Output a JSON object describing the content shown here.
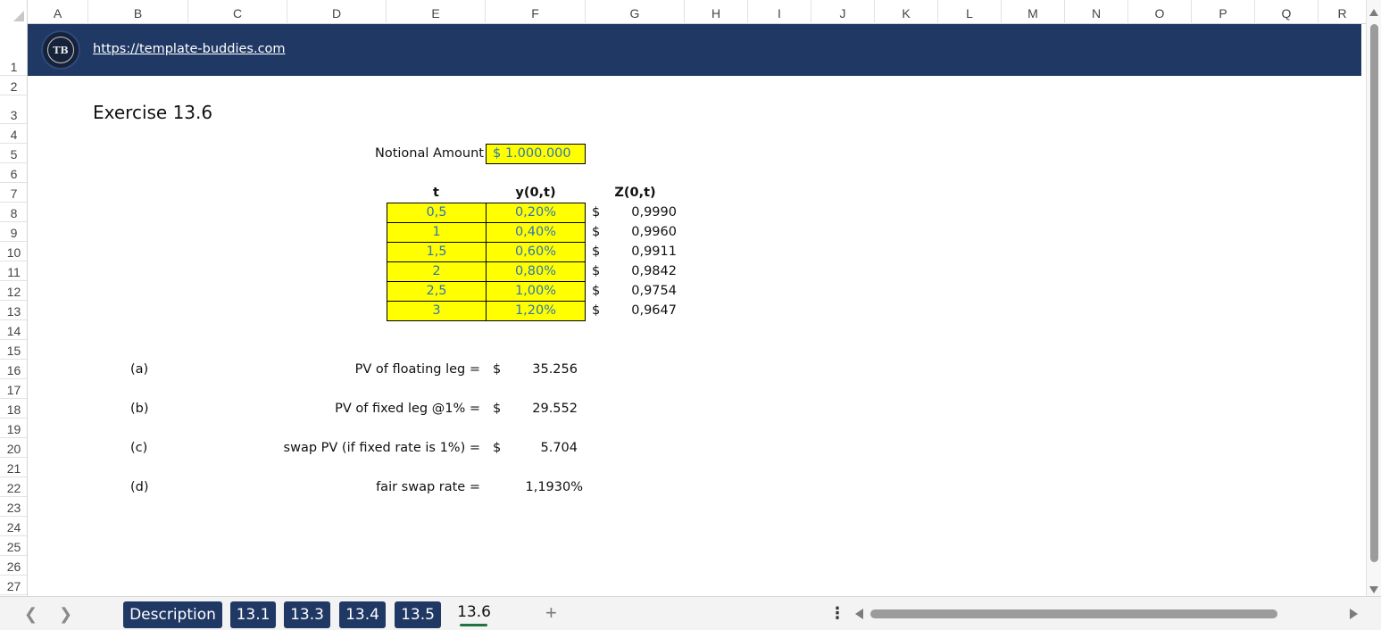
{
  "columns": [
    "A",
    "B",
    "C",
    "D",
    "E",
    "F",
    "G",
    "H",
    "I",
    "J",
    "K",
    "L",
    "M",
    "N",
    "O",
    "P",
    "Q",
    "R"
  ],
  "rows": [
    "1",
    "2",
    "3",
    "4",
    "5",
    "6",
    "7",
    "8",
    "9",
    "10",
    "11",
    "12",
    "13",
    "14",
    "15",
    "16",
    "17",
    "18",
    "19",
    "20",
    "21",
    "22",
    "23",
    "24",
    "25",
    "26",
    "27"
  ],
  "banner": {
    "logo_text": "TB",
    "link": "https://template-buddies.com"
  },
  "sheet": {
    "title": "Exercise 13.6",
    "notional_label": "Notional Amount",
    "notional_value": "$   1.000.000",
    "table": {
      "headers": [
        "t",
        "y(0,t)",
        "Z(0,t)"
      ],
      "rows": [
        {
          "t": "0,5",
          "y": "0,20%",
          "cur": "$",
          "z": "0,9990"
        },
        {
          "t": "1",
          "y": "0,40%",
          "cur": "$",
          "z": "0,9960"
        },
        {
          "t": "1,5",
          "y": "0,60%",
          "cur": "$",
          "z": "0,9911"
        },
        {
          "t": "2",
          "y": "0,80%",
          "cur": "$",
          "z": "0,9842"
        },
        {
          "t": "2,5",
          "y": "1,00%",
          "cur": "$",
          "z": "0,9754"
        },
        {
          "t": "3",
          "y": "1,20%",
          "cur": "$",
          "z": "0,9647"
        }
      ]
    },
    "answers": [
      {
        "letter": "(a)",
        "label": "PV of floating leg =",
        "cur": "$",
        "value": "35.256"
      },
      {
        "letter": "(b)",
        "label": "PV of fixed leg @1% =",
        "cur": "$",
        "value": "29.552"
      },
      {
        "letter": "(c)",
        "label": "swap PV (if fixed rate is 1%) =",
        "cur": "$",
        "value": "5.704"
      },
      {
        "letter": "(d)",
        "label": "fair swap rate =",
        "cur": "",
        "value": "1,1930%"
      }
    ]
  },
  "tabs": {
    "prev_icon": "chevron-left-icon",
    "next_icon": "chevron-right-icon",
    "items": [
      "Description",
      "13.1",
      "13.3",
      "13.4",
      "13.5",
      "13.6"
    ],
    "active": "13.6",
    "add_label": "+",
    "more_label": "⋮"
  },
  "colors": {
    "banner": "#203864",
    "highlight": "#ffff00",
    "input_text": "#2e75b6",
    "active_tab_underline": "#217346"
  }
}
